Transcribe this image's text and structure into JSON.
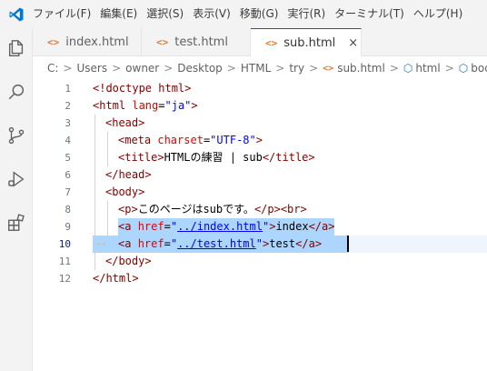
{
  "menu": [
    "ファイル(F)",
    "編集(E)",
    "選択(S)",
    "表示(V)",
    "移動(G)",
    "実行(R)",
    "ターミナル(T)",
    "ヘルプ(H)"
  ],
  "tabs": [
    {
      "label": "index.html",
      "icon": "html-file-icon",
      "active": false
    },
    {
      "label": "test.html",
      "icon": "html-file-icon",
      "active": false
    },
    {
      "label": "sub.html",
      "icon": "html-file-icon",
      "active": true
    }
  ],
  "tab_close_glyph": "×",
  "breadcrumb": {
    "parts": [
      "C:",
      "Users",
      "owner",
      "Desktop",
      "HTML",
      "try",
      "sub.html",
      "html",
      "body"
    ],
    "separator": ">"
  },
  "editor": {
    "current_line": 10,
    "lines": [
      {
        "n": "1",
        "segs": [
          [
            "t",
            "<!doctype html>"
          ]
        ]
      },
      {
        "n": "2",
        "segs": [
          [
            "t",
            "<html "
          ],
          [
            "a",
            "lang"
          ],
          [
            "p",
            "="
          ],
          [
            "v",
            "\"ja\""
          ],
          [
            "t",
            ">"
          ]
        ]
      },
      {
        "n": "3",
        "segs": [
          [
            "t",
            "<head>"
          ]
        ]
      },
      {
        "n": "4",
        "segs": [
          [
            "t",
            "<meta "
          ],
          [
            "a",
            "charset"
          ],
          [
            "p",
            "="
          ],
          [
            "v",
            "\"UTF-8\""
          ],
          [
            "t",
            ">"
          ]
        ]
      },
      {
        "n": "5",
        "segs": [
          [
            "t",
            "<title>"
          ],
          [
            "p",
            "HTMLの練習 | sub"
          ],
          [
            "t",
            "</title>"
          ]
        ]
      },
      {
        "n": "6",
        "segs": [
          [
            "t",
            "</head>"
          ]
        ]
      },
      {
        "n": "7",
        "segs": [
          [
            "t",
            "<body>"
          ]
        ]
      },
      {
        "n": "8",
        "segs": [
          [
            "t",
            "<p>"
          ],
          [
            "p",
            "このページはsubです。"
          ],
          [
            "t",
            "</p><br>"
          ]
        ]
      },
      {
        "n": "9",
        "segs": [
          [
            "t",
            "<a "
          ],
          [
            "a",
            "href"
          ],
          [
            "p",
            "="
          ],
          [
            "v",
            "\""
          ],
          [
            "lk",
            "../index.html"
          ],
          [
            "v",
            "\""
          ],
          [
            "t",
            ">"
          ],
          [
            "p",
            "index"
          ],
          [
            "t",
            "</a>"
          ]
        ]
      },
      {
        "n": "10",
        "segs": [
          [
            "t",
            "<a "
          ],
          [
            "a",
            "href"
          ],
          [
            "p",
            "="
          ],
          [
            "v",
            "\""
          ],
          [
            "lk",
            "../test.html"
          ],
          [
            "v",
            "\""
          ],
          [
            "t",
            ">"
          ],
          [
            "p",
            "test"
          ],
          [
            "t",
            "</a>"
          ]
        ]
      },
      {
        "n": "11",
        "segs": [
          [
            "t",
            "</body>"
          ]
        ]
      },
      {
        "n": "12",
        "segs": [
          [
            "t",
            "</html>"
          ]
        ]
      }
    ]
  },
  "colors": {
    "tag": "#800000",
    "attribute": "#e50000",
    "string": "#0000ff",
    "text": "#000000",
    "selection": "#add6ff",
    "accent": "#005fb8"
  }
}
